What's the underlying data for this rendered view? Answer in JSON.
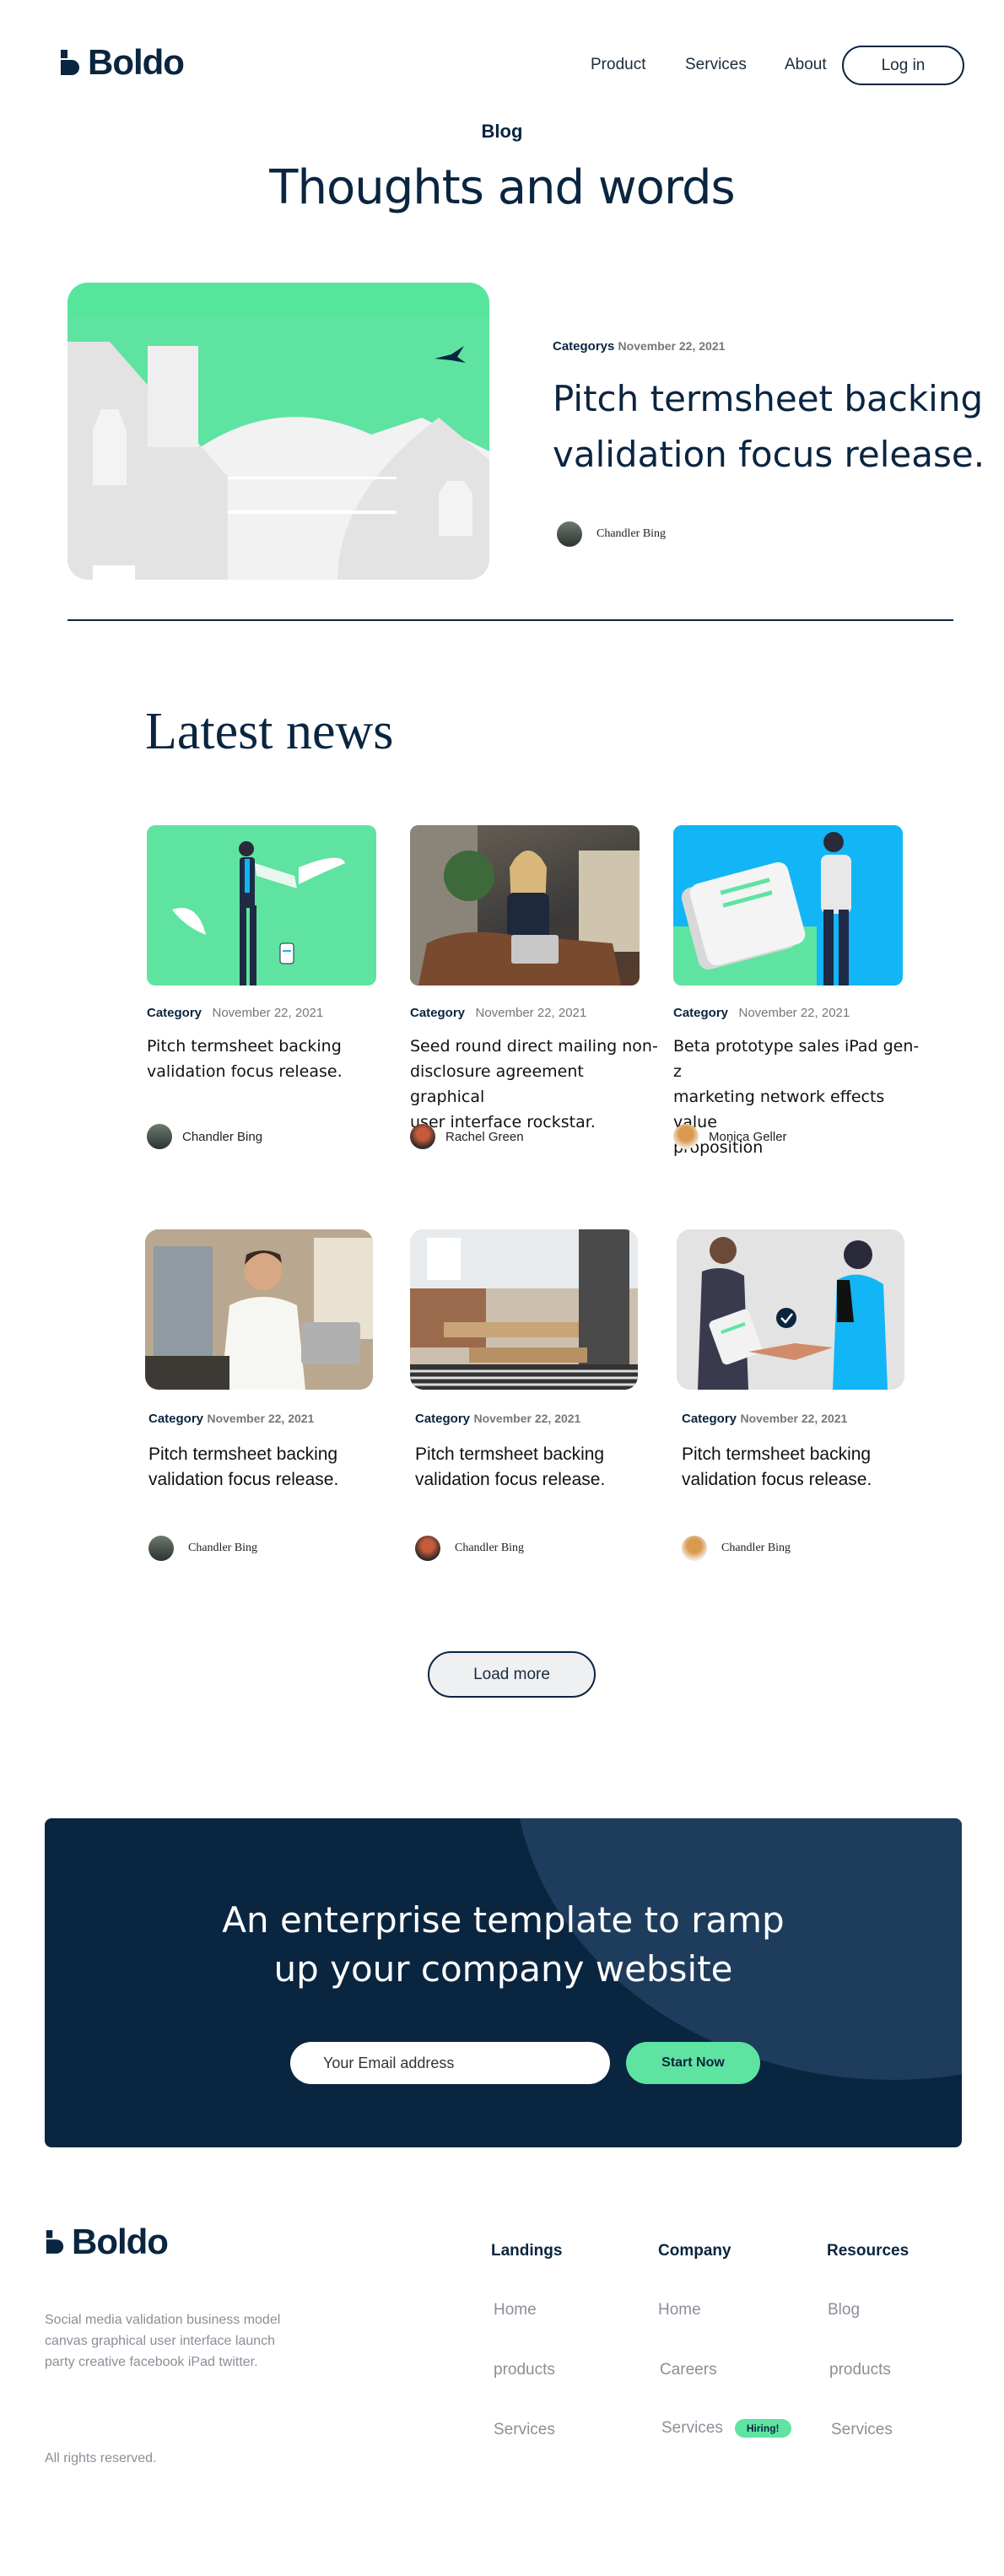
{
  "brand": {
    "name": "Boldo"
  },
  "nav": {
    "product": "Product",
    "services": "Services",
    "about": "About",
    "login": "Log in"
  },
  "hero": {
    "eyebrow": "Blog",
    "title": "Thoughts and words"
  },
  "featured": {
    "category": "Categorys",
    "date": "November 22, 2021",
    "title_line1": "Pitch termsheet backing",
    "title_line2": "validation focus release.",
    "author": "Chandler Bing"
  },
  "latest": {
    "title": "Latest news",
    "row1": [
      {
        "category": "Category",
        "date": "November 22, 2021",
        "title": [
          "Pitch termsheet backing",
          "validation focus release."
        ],
        "author": "Chandler Bing"
      },
      {
        "category": "Category",
        "date": "November 22, 2021",
        "title": [
          "Seed round direct mailing non-",
          "disclosure agreement graphical",
          "user interface rockstar."
        ],
        "author": "Rachel Green"
      },
      {
        "category": "Category",
        "date": "November 22, 2021",
        "title": [
          "Beta prototype sales iPad gen-z",
          "marketing network effects value",
          "proposition"
        ],
        "author": "Monica Geller"
      }
    ],
    "row2": [
      {
        "category": "Category",
        "date": "November 22, 2021",
        "title": [
          "Pitch termsheet backing",
          "validation focus release."
        ],
        "author": "Chandler Bing"
      },
      {
        "category": "Category",
        "date": "November 22, 2021",
        "title": [
          "Pitch termsheet backing",
          "validation focus release."
        ],
        "author": "Chandler Bing"
      },
      {
        "category": "Category",
        "date": "November 22, 2021",
        "title": [
          "Pitch termsheet backing",
          "validation focus release."
        ],
        "author": "Chandler Bing"
      }
    ],
    "load_more": "Load more"
  },
  "cta": {
    "line1": "An enterprise template to ramp",
    "line2": "up your company website",
    "email_placeholder": "Your Email address",
    "button": "Start Now"
  },
  "footer": {
    "brand": "Boldo",
    "description": [
      "Social media validation business model",
      "canvas graphical user interface launch",
      "party creative facebook iPad twitter."
    ],
    "rights": "All rights reserved.",
    "columns": [
      {
        "heading": "Landings",
        "links": [
          "Home",
          "products",
          "Services"
        ]
      },
      {
        "heading": "Company",
        "links": [
          "Home",
          "Careers",
          "Services"
        ],
        "badge": "Hiring!"
      },
      {
        "heading": "Resources",
        "links": [
          "Blog",
          "products",
          "Services"
        ]
      }
    ]
  },
  "colors": {
    "navy": "#0a2540",
    "green": "#5fe3a1",
    "blue": "#12b5f5"
  }
}
